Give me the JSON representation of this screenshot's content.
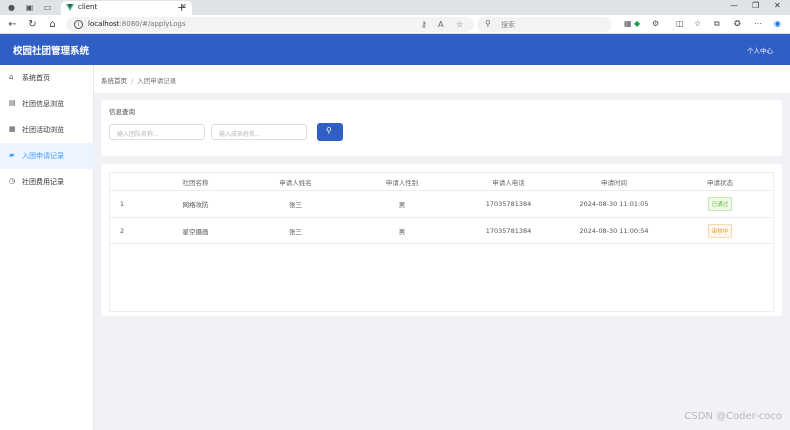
{
  "browser": {
    "tab_title": "client",
    "url_host": "localhost",
    "url_rest": ":8080/#/applyLogs",
    "search_placeholder": "搜索"
  },
  "header": {
    "app_title": "校园社团管理系统",
    "user_center": "个人中心"
  },
  "sidebar": {
    "items": [
      {
        "label": "系统首页",
        "icon": "home-icon"
      },
      {
        "label": "社团信息浏览",
        "icon": "notebook-icon"
      },
      {
        "label": "社团活动浏览",
        "icon": "calendar-icon"
      },
      {
        "label": "入团申请记录",
        "icon": "folder-icon",
        "active": true
      },
      {
        "label": "社团费用记录",
        "icon": "clock-icon"
      }
    ]
  },
  "breadcrumb": {
    "home": "系统首页",
    "separator": "/",
    "current": "入团申请记录"
  },
  "search_card": {
    "title": "信息查询",
    "club_name_placeholder": "输入团队名称...",
    "applicant_placeholder": "输入成员姓名...",
    "search_icon": "search-icon"
  },
  "table": {
    "columns": [
      "",
      "社团名称",
      "申请人姓名",
      "申请人性别",
      "申请人电话",
      "申请时间",
      "申请状态"
    ],
    "rows": [
      {
        "index": "1",
        "club": "网络攻防",
        "name": "张三",
        "gender": "男",
        "phone": "17035781384",
        "time": "2024-08-30 11:01:05",
        "status": "已通过",
        "status_type": "ok"
      },
      {
        "index": "2",
        "club": "星空摄画",
        "name": "张三",
        "gender": "男",
        "phone": "17035781384",
        "time": "2024-08-30 11:00:54",
        "status": "审核中",
        "status_type": "pending"
      }
    ]
  },
  "colors": {
    "brand": "#2f5ec4",
    "active_menu": "#409eff",
    "status_ok": "#67c23a",
    "status_pending": "#e6a23c"
  },
  "watermark": "CSDN @Coder-coco"
}
